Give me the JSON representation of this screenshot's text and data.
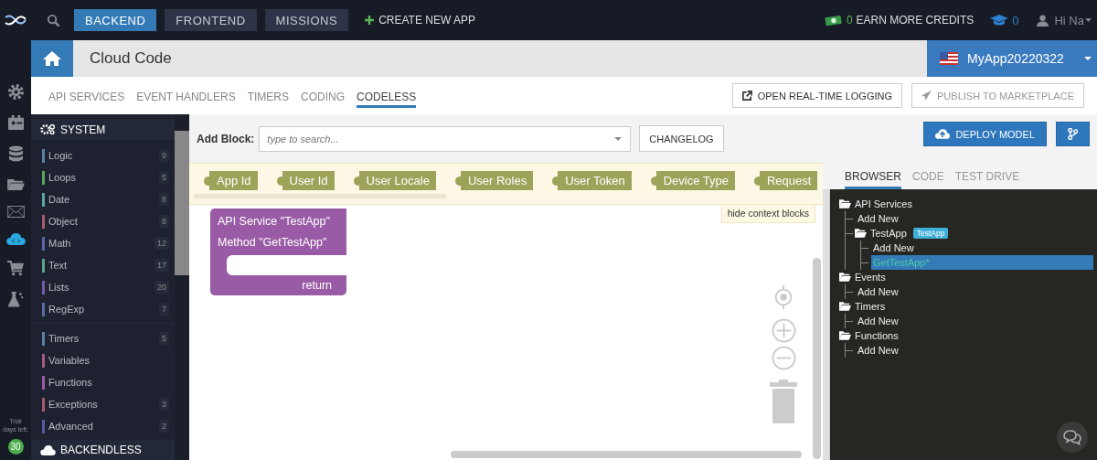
{
  "top_nav": {
    "buttons": [
      {
        "label": "BACKEND",
        "selected": true
      },
      {
        "label": "FRONTEND",
        "selected": false
      },
      {
        "label": "MISSIONS",
        "selected": false
      }
    ],
    "create_app": "CREATE NEW APP",
    "credits": {
      "count": "0",
      "label": "EARN MORE CREDITS"
    },
    "education_count": "0",
    "user": "Hi Na"
  },
  "rail": {
    "items": [
      {
        "kind": "settings",
        "selected": false
      },
      {
        "kind": "calendar",
        "selected": false
      },
      {
        "kind": "database",
        "selected": false
      },
      {
        "kind": "folder",
        "selected": false
      },
      {
        "kind": "mail",
        "selected": false
      },
      {
        "kind": "cloud",
        "selected": true
      },
      {
        "kind": "cart",
        "selected": false
      },
      {
        "kind": "flask",
        "selected": false
      }
    ],
    "trial_label": "Trial days left:",
    "trial_days": "30"
  },
  "header": {
    "title": "Cloud Code",
    "app": "MyApp20220322"
  },
  "tabs": [
    {
      "label": "API SERVICES",
      "selected": false
    },
    {
      "label": "EVENT HANDLERS",
      "selected": false
    },
    {
      "label": "TIMERS",
      "selected": false
    },
    {
      "label": "CODING",
      "selected": false
    },
    {
      "label": "CODELESS",
      "selected": true
    }
  ],
  "actions": [
    {
      "label": "OPEN REAL-TIME LOGGING",
      "disabled": false
    },
    {
      "label": "PUBLISH TO MARKETPLACE",
      "disabled": true
    }
  ],
  "sidebar": {
    "section": "SYSTEM",
    "groups": [
      [
        {
          "label": "Logic",
          "count": "9",
          "color": "#5b80a5"
        },
        {
          "label": "Loops",
          "count": "5",
          "color": "#5ba55b"
        },
        {
          "label": "Date",
          "count": "8",
          "color": "#5ba5a5"
        },
        {
          "label": "Object",
          "count": "8",
          "color": "#a55b6d"
        },
        {
          "label": "Math",
          "count": "12",
          "color": "#5b67a5"
        },
        {
          "label": "Text",
          "count": "17",
          "color": "#5ba58c"
        },
        {
          "label": "Lists",
          "count": "20",
          "color": "#745ba5"
        },
        {
          "label": "RegExp",
          "count": "7",
          "color": "#5b6da5"
        }
      ],
      [
        {
          "label": "Timers",
          "count": "5",
          "color": "#5b80a5"
        },
        {
          "label": "Variables",
          "color": "#a55b80"
        },
        {
          "label": "Functions",
          "color": "#995ba5"
        },
        {
          "label": "Exceptions",
          "count": "3",
          "color": "#a55b6b"
        },
        {
          "label": "Advanced",
          "count": "2",
          "color": "#5b5ba5"
        }
      ]
    ],
    "next_section": "BACKENDLESS"
  },
  "add_block": {
    "label": "Add Block:",
    "placeholder": "type to search...",
    "changelog": "CHANGELOG"
  },
  "context_blocks": [
    "App Id",
    "User Id",
    "User Locale",
    "User Roles",
    "User Token",
    "Device Type",
    "Request"
  ],
  "hide_context": "hide context blocks",
  "method_block": {
    "lines": [
      "API Service \"TestApp\"",
      "Method \"GetTestApp\""
    ],
    "return": "return"
  },
  "deploy": "DEPLOY MODEL",
  "panel_tabs": [
    {
      "label": "BROWSER",
      "selected": true
    },
    {
      "label": "CODE",
      "selected": false
    },
    {
      "label": "TEST DRIVE",
      "selected": false
    }
  ],
  "tree": [
    {
      "label": "API Services",
      "kind": "folder",
      "selected": false,
      "children": [
        {
          "label": "Add New",
          "kind": "leaf",
          "selected": false
        },
        {
          "label": "TestApp",
          "kind": "folder",
          "selected": false,
          "tag": "TestApp",
          "children": [
            {
              "label": "Add New",
              "kind": "leaf",
              "selected": false
            },
            {
              "label": "GetTestApp*",
              "kind": "leaf",
              "selected": true
            }
          ]
        }
      ]
    },
    {
      "label": "Events",
      "kind": "folder",
      "selected": false,
      "children": [
        {
          "label": "Add New",
          "kind": "leaf",
          "selected": false
        }
      ]
    },
    {
      "label": "Timers",
      "kind": "folder",
      "selected": false,
      "children": [
        {
          "label": "Add New",
          "kind": "leaf",
          "selected": false
        }
      ]
    },
    {
      "label": "Functions",
      "kind": "folder",
      "selected": false,
      "children": [
        {
          "label": "Add New",
          "kind": "leaf",
          "selected": false
        }
      ]
    }
  ]
}
